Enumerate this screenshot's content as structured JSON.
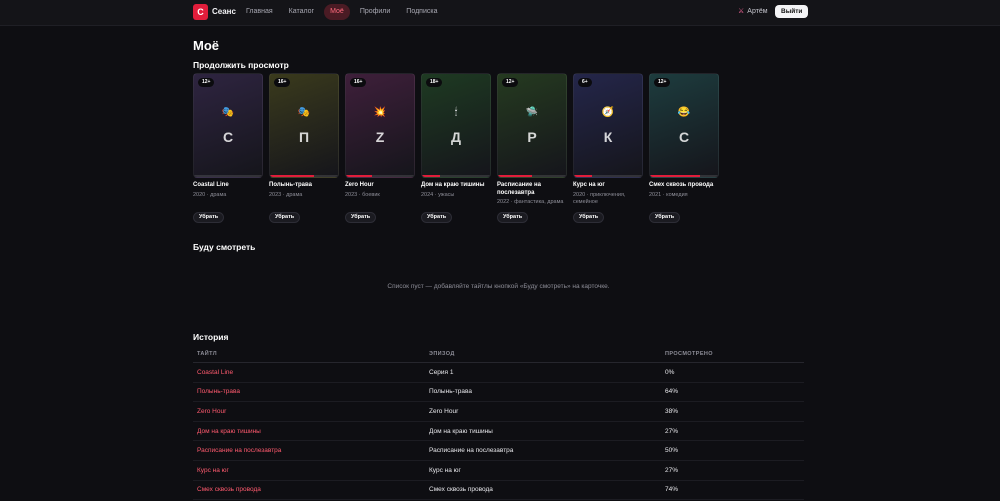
{
  "app": {
    "brand": "Сеанс",
    "logo_letter": "С",
    "accent_color": "#e11d3b"
  },
  "nav": {
    "items": [
      {
        "label": "Главная",
        "active": false
      },
      {
        "label": "Каталог",
        "active": false
      },
      {
        "label": "Моё",
        "active": true
      },
      {
        "label": "Профили",
        "active": false
      },
      {
        "label": "Подписка",
        "active": false
      }
    ]
  },
  "user": {
    "icon": "user-icon",
    "name": "Артём",
    "logout_label": "Выйти"
  },
  "page": {
    "title": "Моё"
  },
  "continue": {
    "title": "Продолжить просмотр",
    "remove_label": "Убрать",
    "cards": [
      {
        "title": "Coastal Line",
        "meta": "2020 · драма",
        "age": "12+",
        "letter": "C",
        "emoji": "🎭",
        "progress": 0,
        "color": "#2e2440"
      },
      {
        "title": "Полынь-трава",
        "meta": "2023 · драма",
        "age": "16+",
        "letter": "П",
        "emoji": "🎭",
        "progress": 0.64,
        "color": "#3a3a1c"
      },
      {
        "title": "Zero Hour",
        "meta": "2023 · боевик",
        "age": "16+",
        "letter": "Z",
        "emoji": "💥",
        "progress": 0.38,
        "color": "#3e1f3a"
      },
      {
        "title": "Дом на краю тишины",
        "meta": "2024 · ужасы",
        "age": "18+",
        "letter": "Д",
        "emoji": "🕯",
        "progress": 0.27,
        "color": "#1e3a22"
      },
      {
        "title": "Расписание на послезавтра",
        "meta": "2022 · фантастика, драма",
        "age": "12+",
        "letter": "Р",
        "emoji": "🛸",
        "progress": 0.5,
        "color": "#253a20"
      },
      {
        "title": "Курс на юг",
        "meta": "2020 · приключения, семейное",
        "age": "6+",
        "letter": "К",
        "emoji": "🧭",
        "progress": 0.27,
        "color": "#24264a"
      },
      {
        "title": "Смех сквозь провода",
        "meta": "2021 · комедия",
        "age": "12+",
        "letter": "С",
        "emoji": "😂",
        "progress": 0.74,
        "color": "#1d3c3e"
      }
    ]
  },
  "watchlist": {
    "title": "Буду смотреть",
    "empty_text": "Список пуст — добавляйте тайтлы кнопкой «Буду смотреть» на карточке."
  },
  "history": {
    "title": "История",
    "columns": [
      "ТАЙТЛ",
      "ЭПИЗОД",
      "ПРОСМОТРЕНО"
    ],
    "rows": [
      {
        "title": "Coastal Line",
        "episode": "Серия 1",
        "watched": "0%"
      },
      {
        "title": "Полынь-трава",
        "episode": "Полынь-трава",
        "watched": "64%"
      },
      {
        "title": "Zero Hour",
        "episode": "Zero Hour",
        "watched": "38%"
      },
      {
        "title": "Дом на краю тишины",
        "episode": "Дом на краю тишины",
        "watched": "27%"
      },
      {
        "title": "Расписание на послезавтра",
        "episode": "Расписание на послезавтра",
        "watched": "50%"
      },
      {
        "title": "Курс на юг",
        "episode": "Курс на юг",
        "watched": "27%"
      },
      {
        "title": "Смех сквозь провода",
        "episode": "Смех сквозь провода",
        "watched": "74%"
      }
    ]
  }
}
